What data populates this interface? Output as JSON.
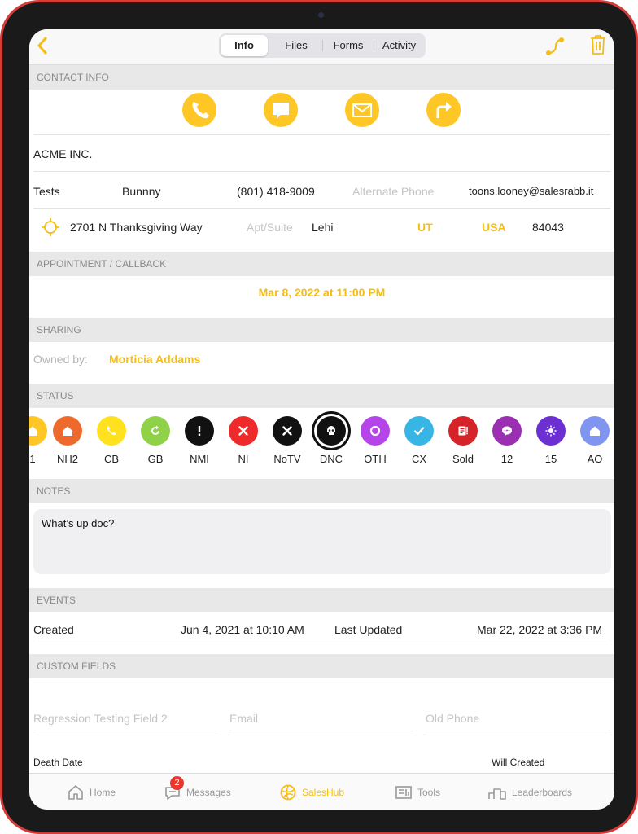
{
  "tabs": [
    "Info",
    "Files",
    "Forms",
    "Activity"
  ],
  "sections": {
    "contact": "CONTACT INFO",
    "appointment": "APPOINTMENT / CALLBACK",
    "sharing": "SHARING",
    "status": "STATUS",
    "notes": "NOTES",
    "events": "EVENTS",
    "custom": "CUSTOM FIELDS"
  },
  "contact": {
    "company": "ACME INC.",
    "first_name": "Tests",
    "last_name": "Bunnny",
    "phone": "(801) 418-9009",
    "alt_phone_placeholder": "Alternate Phone",
    "email": "toons.looney@salesrabb.it",
    "street": "2701 N Thanksgiving Way",
    "apt_placeholder": "Apt/Suite",
    "city": "Lehi",
    "state": "UT",
    "country": "USA",
    "zip": "84043"
  },
  "appointment": "Mar 8, 2022 at 11:00 PM",
  "sharing": {
    "owned_by_label": "Owned by:",
    "owner": "Morticia Addams"
  },
  "statuses": [
    {
      "label": "1",
      "color": "#ffc726",
      "icon": "home-icon"
    },
    {
      "label": "NH2",
      "color": "#ee6a2c",
      "icon": "home-icon"
    },
    {
      "label": "CB",
      "color": "#ffe11f",
      "icon": "phone-icon"
    },
    {
      "label": "GB",
      "color": "#8fd147",
      "icon": "refresh-icon"
    },
    {
      "label": "NMI",
      "color": "#111111",
      "icon": "exclamation-icon"
    },
    {
      "label": "NI",
      "color": "#ee2a2a",
      "icon": "x-icon"
    },
    {
      "label": "NoTV",
      "color": "#111111",
      "icon": "x-icon"
    },
    {
      "label": "DNC",
      "color": "#111111",
      "icon": "skull-icon"
    },
    {
      "label": "OTH",
      "color": "#b545e8",
      "icon": "ring-icon"
    },
    {
      "label": "CX",
      "color": "#37b6e6",
      "icon": "check-icon"
    },
    {
      "label": "Sold",
      "color": "#d6232a",
      "icon": "receipt-icon"
    },
    {
      "label": "12",
      "color": "#9a2fb2",
      "icon": "chat-icon"
    },
    {
      "label": "15",
      "color": "#6b2fd2",
      "icon": "sun-icon"
    },
    {
      "label": "AO",
      "color": "#7f95ef",
      "icon": "home-icon"
    }
  ],
  "notes": "What’s up doc?",
  "events": {
    "created_label": "Created",
    "created_value": "Jun 4, 2021 at 10:10 AM",
    "updated_label": "Last Updated",
    "updated_value": "Mar 22, 2022 at 3:36 PM"
  },
  "custom_fields": {
    "regression_placeholder": "Regression Testing Field 2",
    "email_placeholder": "Email",
    "old_phone_placeholder": "Old Phone",
    "death_date_label": "Death Date",
    "will_created_label": "Will Created"
  },
  "bottom_tabs": [
    {
      "label": "Home",
      "icon": "home-icon"
    },
    {
      "label": "Messages",
      "icon": "messages-icon",
      "badge": "2"
    },
    {
      "label": "SalesHub",
      "icon": "saleshub-icon"
    },
    {
      "label": "Tools",
      "icon": "tools-icon"
    },
    {
      "label": "Leaderboards",
      "icon": "leaderboards-icon"
    }
  ],
  "colors": {
    "accent": "#ffc726",
    "accent_text": "#f5bd12"
  }
}
